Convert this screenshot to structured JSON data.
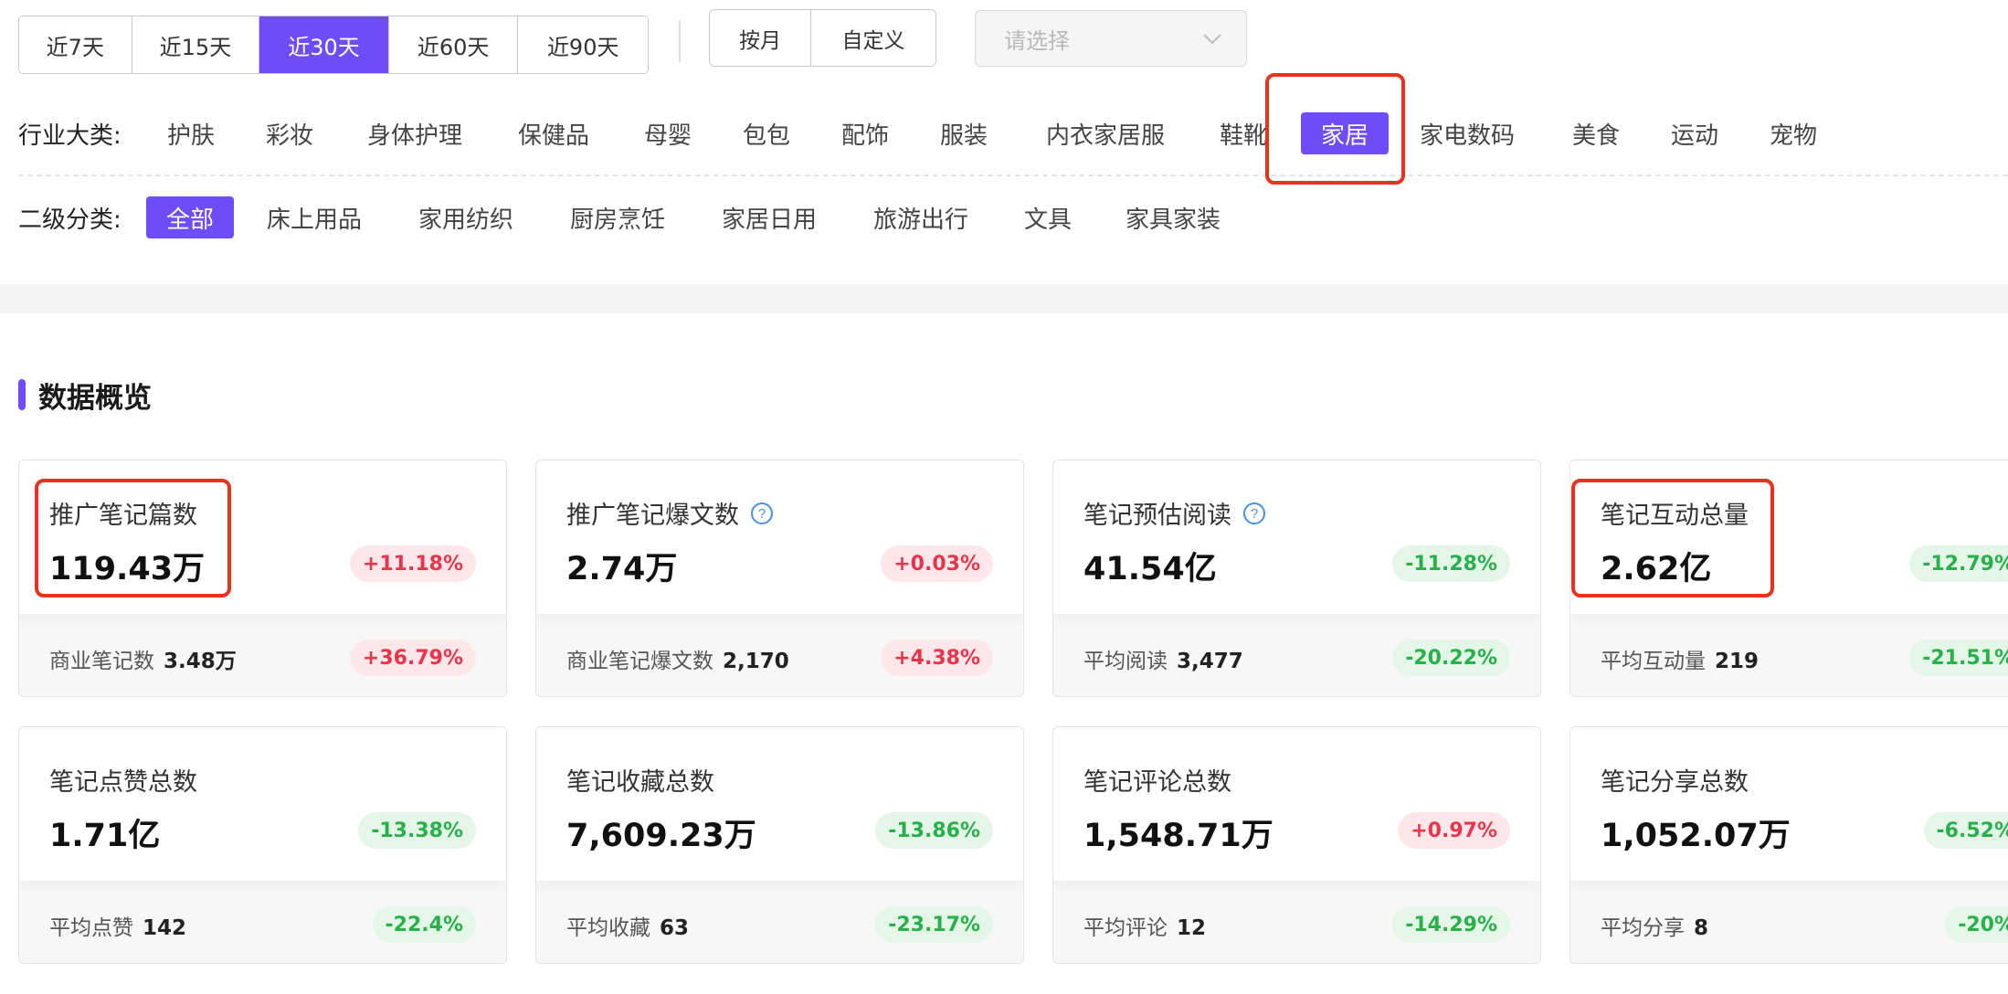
{
  "time_range": {
    "options": [
      "近7天",
      "近15天",
      "近30天",
      "近60天",
      "近90天"
    ],
    "selected": "近30天"
  },
  "period_mode": {
    "options": [
      "按月",
      "自定义"
    ]
  },
  "select": {
    "placeholder": "请选择"
  },
  "industry": {
    "label": "行业大类:",
    "items": [
      "护肤",
      "彩妆",
      "身体护理",
      "保健品",
      "母婴",
      "包包",
      "配饰",
      "服装",
      "内衣家居服",
      "鞋靴",
      "家居",
      "家电数码",
      "美食",
      "运动",
      "宠物"
    ],
    "selected": "家居"
  },
  "subcategory": {
    "label": "二级分类:",
    "items": [
      "全部",
      "床上用品",
      "家用纺织",
      "厨房烹饪",
      "家居日用",
      "旅游出行",
      "文具",
      "家具家装"
    ],
    "selected": "全部"
  },
  "overview": {
    "title": "数据概览",
    "cards": [
      {
        "title": "推广笔记篇数",
        "value": "119.43万",
        "change": "+11.18%",
        "trend": "up",
        "help": false,
        "sub_label": "商业笔记数",
        "sub_value": "3.48万",
        "sub_change": "+36.79%",
        "sub_trend": "up"
      },
      {
        "title": "推广笔记爆文数",
        "value": "2.74万",
        "change": "+0.03%",
        "trend": "up",
        "help": true,
        "sub_label": "商业笔记爆文数",
        "sub_value": "2,170",
        "sub_change": "+4.38%",
        "sub_trend": "up"
      },
      {
        "title": "笔记预估阅读",
        "value": "41.54亿",
        "change": "-11.28%",
        "trend": "down",
        "help": true,
        "sub_label": "平均阅读",
        "sub_value": "3,477",
        "sub_change": "-20.22%",
        "sub_trend": "down"
      },
      {
        "title": "笔记互动总量",
        "value": "2.62亿",
        "change": "-12.79%",
        "trend": "down",
        "help": false,
        "sub_label": "平均互动量",
        "sub_value": "219",
        "sub_change": "-21.51%",
        "sub_trend": "down"
      },
      {
        "title": "笔记点赞总数",
        "value": "1.71亿",
        "change": "-13.38%",
        "trend": "down",
        "help": false,
        "sub_label": "平均点赞",
        "sub_value": "142",
        "sub_change": "-22.4%",
        "sub_trend": "down"
      },
      {
        "title": "笔记收藏总数",
        "value": "7,609.23万",
        "change": "-13.86%",
        "trend": "down",
        "help": false,
        "sub_label": "平均收藏",
        "sub_value": "63",
        "sub_change": "-23.17%",
        "sub_trend": "down"
      },
      {
        "title": "笔记评论总数",
        "value": "1,548.71万",
        "change": "+0.97%",
        "trend": "up",
        "help": false,
        "sub_label": "平均评论",
        "sub_value": "12",
        "sub_change": "-14.29%",
        "sub_trend": "down"
      },
      {
        "title": "笔记分享总数",
        "value": "1,052.07万",
        "change": "-6.52%",
        "trend": "down",
        "help": false,
        "sub_label": "平均分享",
        "sub_value": "8",
        "sub_change": "-20%",
        "sub_trend": "down"
      }
    ]
  },
  "colors": {
    "accent": "#6e4df6",
    "highlight": "#e8311f",
    "up": "#e8354b",
    "down": "#28b04b"
  }
}
